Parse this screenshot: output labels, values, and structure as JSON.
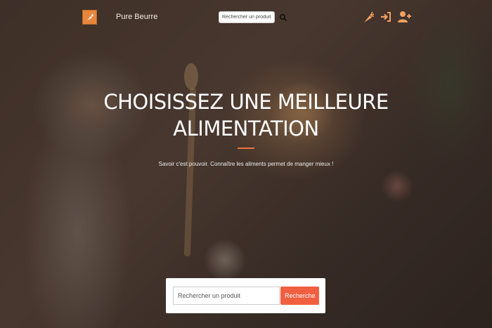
{
  "navbar": {
    "logo_icon": "carrot-logo-icon",
    "brand": "Pure Beurre",
    "search_placeholder": "Rechercher un produit",
    "search_icon": "search-icon",
    "icons": [
      "carrot-icon",
      "login-icon",
      "user-plus-icon"
    ]
  },
  "hero": {
    "title_line1": "CHOISISSEZ UNE MEILLEURE",
    "title_line2": "ALIMENTATION",
    "subtitle": "Savoir c'est pouvoir. Connaître les aliments permet de manger mieux !",
    "accent": "#e8743b"
  },
  "search": {
    "placeholder": "Rechercher un produit",
    "button_label": "Recherche",
    "button_color": "#f05f40"
  }
}
